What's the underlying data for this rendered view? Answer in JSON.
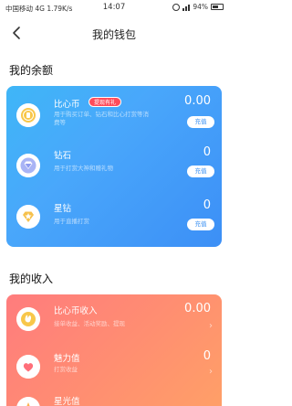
{
  "status_bar": {
    "left": "中国移动 4G 1.79K/s",
    "time": "14:07",
    "right": "94%"
  },
  "navbar": {
    "title": "我的钱包"
  },
  "balance": {
    "section_title": "我的余额",
    "items": [
      {
        "title": "比心币",
        "badge": "提现有礼",
        "desc": "用于购买订单、钻石和比心打赏等消费等",
        "value": "0.00",
        "button": "充值",
        "icon": "coin-icon"
      },
      {
        "title": "钻石",
        "desc": "用于打赏大神和赠礼物",
        "value": "0",
        "button": "充值",
        "icon": "diamond-icon"
      },
      {
        "title": "星钻",
        "desc": "用于直播打赏",
        "value": "0",
        "button": "充值",
        "icon": "star-diamond-icon"
      }
    ]
  },
  "income": {
    "section_title": "我的收入",
    "items": [
      {
        "title": "比心币收入",
        "desc": "接单收益、活动奖励、提现",
        "value": "0.00",
        "icon": "hand-coin-icon"
      },
      {
        "title": "魅力值",
        "desc": "打赏收益",
        "value": "0",
        "icon": "heart-icon"
      },
      {
        "title": "星光值",
        "desc": "",
        "value": "",
        "icon": "star-light-icon"
      }
    ]
  },
  "colors": {
    "balance_gradient": [
      "#3fb6f7",
      "#3c8ff6"
    ],
    "income_gradient": [
      "#ff7c7d",
      "#ffa067"
    ],
    "badge": "#ff4b5a"
  }
}
